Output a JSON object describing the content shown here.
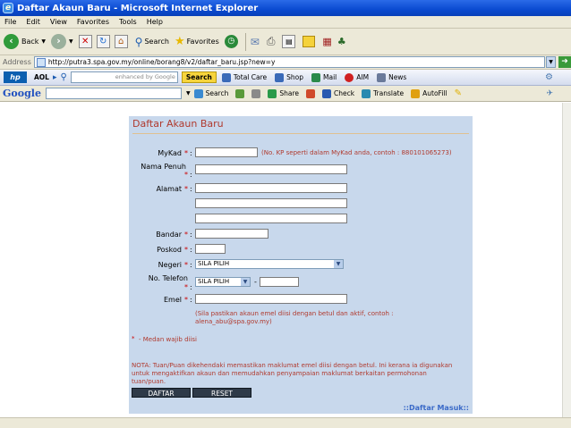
{
  "window": {
    "title": "Daftar Akaun Baru - Microsoft Internet Explorer"
  },
  "menu": [
    "File",
    "Edit",
    "View",
    "Favorites",
    "Tools",
    "Help"
  ],
  "toolbar": {
    "back": "Back",
    "search": "Search",
    "favorites": "Favorites"
  },
  "address": {
    "label": "Address",
    "url": "http://putra3.spa.gov.my/online/borang8/v2/daftar_baru.jsp?new=y"
  },
  "aol": {
    "brand": "AOL",
    "search_hint": "enhanced by Google",
    "search_btn": "Search",
    "items": [
      "Total Care",
      "Shop",
      "Mail",
      "AIM",
      "News"
    ]
  },
  "google": {
    "logo": "Google",
    "items": [
      "Search",
      "Share",
      "Check",
      "Translate",
      "AutoFill"
    ]
  },
  "form": {
    "title": "Daftar Akaun Baru",
    "mykad_label": "MyKad",
    "mykad_note": "(No. KP seperti dalam MyKad anda, contoh : 880101065273)",
    "nama_label": "Nama Penuh",
    "alamat_label": "Alamat",
    "bandar_label": "Bandar",
    "poskod_label": "Poskod",
    "negeri_label": "Negeri",
    "negeri_value": "SILA PILIH",
    "telefon_label": "No. Telefon",
    "telefon_value": "SILA PILIH",
    "telefon_dash": "-",
    "emel_label": "Emel",
    "emel_note": "(Sila pastikan akaun emel diisi dengan betul dan aktif, contoh : alena_abu@spa.gov.my)",
    "wajib": "- Medan wajib diisi",
    "req_mark": "*",
    "colon": ":",
    "nota": "NOTA: Tuan/Puan dikehendaki memastikan maklumat emel diisi dengan betul. Ini kerana ia digunakan untuk mengaktifkan akaun dan memudahkan penyampaian maklumat berkaitan permohonan tuan/puan.",
    "daftar_btn": "DAFTAR",
    "reset_btn": "RESET",
    "login_link": "::Daftar Masuk::"
  }
}
